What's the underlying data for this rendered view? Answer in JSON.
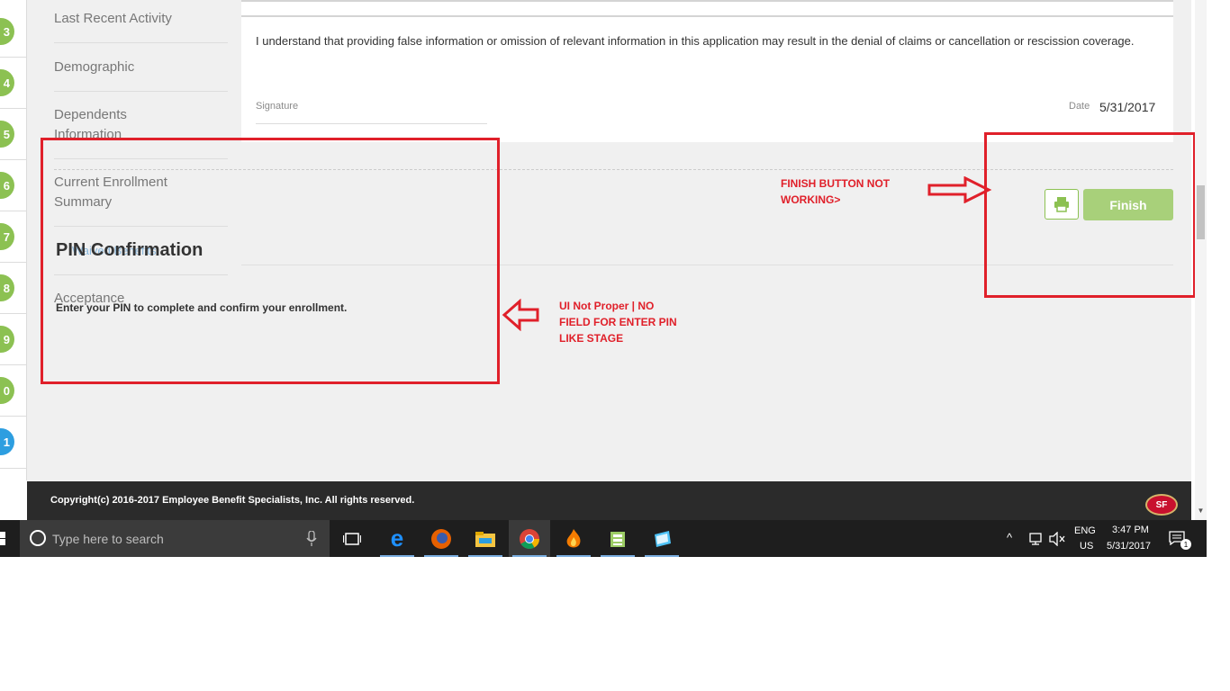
{
  "steps": [
    {
      "label": "3"
    },
    {
      "label": "4"
    },
    {
      "label": "5"
    },
    {
      "label": "6"
    },
    {
      "label": "7"
    },
    {
      "label": "8"
    },
    {
      "label": "9"
    },
    {
      "label": "0"
    },
    {
      "label": "1"
    }
  ],
  "nav": {
    "last_activity": "Last Recent Activity",
    "demographic": "Demographic",
    "dependents_1": "Dependents",
    "dependents_2": "Information",
    "current_enrollment_1": "Current Enrollment",
    "current_enrollment_2": "Summary",
    "overlap_text": "Waived Benefits",
    "acceptance": "Acceptance"
  },
  "content": {
    "disclaimer": "I understand that providing false information or omission of relevant information in this application may result in the denial of claims or cancellation or rescission coverage.",
    "signature_label": "Signature",
    "date_label": "Date",
    "date_value": "5/31/2017"
  },
  "pin": {
    "title": "PIN Confirmation",
    "instructions": "Enter your PIN to complete and confirm your enrollment."
  },
  "buttons": {
    "finish": "Finish",
    "print_icon": "printer-icon"
  },
  "annotations": {
    "finish_note_1": "FINISH BUTTON NOT",
    "finish_note_2": "WORKING>",
    "ui_note_1": "UI Not Proper | NO",
    "ui_note_2": "FIELD FOR ENTER PIN",
    "ui_note_3": "LIKE STAGE",
    "color": "#e0202a"
  },
  "footer": {
    "copyright": "Copyright(c) 2016-2017 Employee Benefit Specialists, Inc. All rights reserved.",
    "logo": "SF"
  },
  "taskbar": {
    "search_placeholder": "Type here to search",
    "lang_1": "ENG",
    "lang_2": "US",
    "time": "3:47 PM",
    "date": "5/31/2017",
    "notifications": "1"
  },
  "colors": {
    "step_green": "#8cc152",
    "step_active": "#2d9ee0",
    "finish_button": "#a8d07a"
  }
}
